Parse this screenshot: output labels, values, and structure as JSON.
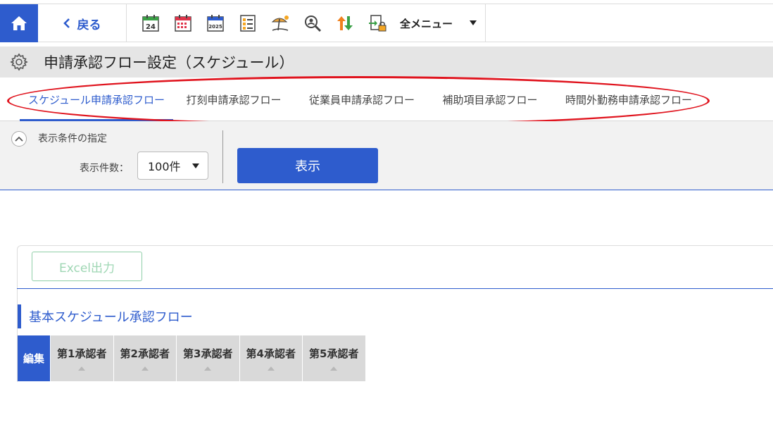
{
  "toolbar": {
    "back_label": "戻る",
    "all_menu_label": "全メニュー",
    "icons": [
      "calendar-24-icon",
      "calendar-grid-icon",
      "calendar-2025-icon",
      "checklist-icon",
      "vacation-icon",
      "search-user-icon",
      "sort-arrows-icon",
      "lock-transfer-icon"
    ]
  },
  "page": {
    "title": "申請承認フロー設定（スケジュール）"
  },
  "tabs": [
    {
      "label": "スケジュール申請承認フロー",
      "active": true
    },
    {
      "label": "打刻申請承認フロー",
      "active": false
    },
    {
      "label": "従業員申請承認フロー",
      "active": false
    },
    {
      "label": "補助項目承認フロー",
      "active": false
    },
    {
      "label": "時間外勤務申請承認フロー",
      "active": false
    }
  ],
  "conditions": {
    "header": "表示条件の指定",
    "count_label": "表示件数：",
    "count_value": "100件",
    "show_button": "表示"
  },
  "content": {
    "excel_button": "Excel出力",
    "section_title": "基本スケジュール承認フロー",
    "table": {
      "edit_header": "編集",
      "columns": [
        "第1承認者",
        "第2承認者",
        "第3承認者",
        "第4承認者",
        "第5承認者"
      ]
    }
  },
  "colors": {
    "accent": "#2e5ccd",
    "highlight": "#e0141e",
    "excel": "#8fcfa8"
  }
}
